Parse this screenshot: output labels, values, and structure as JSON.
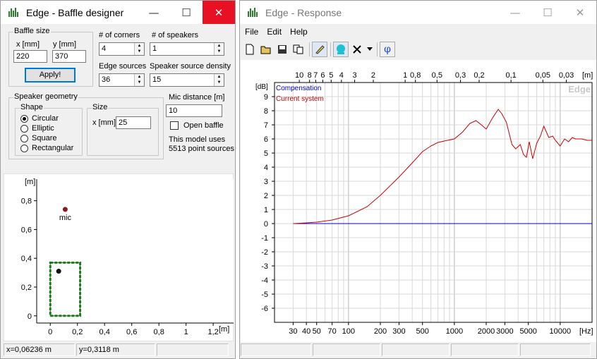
{
  "left_window": {
    "title": "Edge - Baffle designer",
    "baffle_size": {
      "group_label": "Baffle size",
      "x_label": "x [mm]",
      "y_label": "y [mm]",
      "x_value": "220",
      "y_value": "370",
      "apply_label": "Apply!"
    },
    "corners_label": "# of corners",
    "corners_value": "4",
    "speakers_label": "# of speakers",
    "speakers_value": "1",
    "edge_sources_label": "Edge sources",
    "edge_sources_value": "36",
    "density_label": "Speaker source density",
    "density_value": "15",
    "speaker_geometry": {
      "group_label": "Speaker geometry",
      "shape_label": "Shape",
      "shapes": [
        "Circular",
        "Elliptic",
        "Square",
        "Rectangular"
      ],
      "selected_shape": "Circular",
      "size_label": "Size",
      "size_x_label": "x [mm]",
      "size_x_value": "25"
    },
    "mic_distance_label": "Mic distance [m]",
    "mic_distance_value": "10",
    "open_baffle_label": "Open baffle",
    "model_info_line1": "This model uses",
    "model_info_line2": "5513 point sources",
    "plot": {
      "unit_label": "[m]",
      "y_ticks": [
        "0,8",
        "0,6",
        "0,4",
        "0,2",
        "0"
      ],
      "x_ticks": [
        "0",
        "0,2",
        "0,4",
        "0,6",
        "0,8",
        "1",
        "1,2"
      ],
      "x_unit": "[m]",
      "mic_label": "mic"
    },
    "status": {
      "x": "x=0,06236 m",
      "y": "y=0,3118 m"
    }
  },
  "right_window": {
    "title": "Edge - Response",
    "menu": [
      "File",
      "Edit",
      "Help"
    ],
    "toolbar_icons": [
      "new-file-icon",
      "open-folder-icon",
      "save-icon",
      "copy-icon",
      "pencil-icon",
      "speaker-icon",
      "delete-icon",
      "dropdown-icon",
      "phase-icon"
    ],
    "phase_glyph": "φ"
  },
  "chart_data": {
    "type": "line",
    "watermark": "Edge",
    "ylabel": "[dB]",
    "xlabel": "[Hz]",
    "x_scale": "log",
    "xlim": [
      20,
      20000
    ],
    "ylim": [
      -7,
      10
    ],
    "y_ticks": [
      9,
      8,
      7,
      6,
      5,
      4,
      3,
      2,
      1,
      0,
      -1,
      -2,
      -3,
      -4,
      -5,
      -6
    ],
    "x_tick_labels": [
      "30",
      "40",
      "50",
      "70",
      "100",
      "200",
      "300",
      "500",
      "1000",
      "2000",
      "3000",
      "5000",
      "10000"
    ],
    "top_axis_unit": "[m]",
    "top_axis_labels": [
      "10",
      "8",
      "7",
      "6",
      "5",
      "4",
      "3",
      "2",
      "1",
      "0,8",
      "0,5",
      "0,3",
      "0,2",
      "0,1",
      "0,05",
      "0,03"
    ],
    "grid": true,
    "legend_position": "top-left",
    "series": [
      {
        "name": "Compensation",
        "color": "#0000cc",
        "x": [
          30,
          20000
        ],
        "y": [
          0,
          0
        ]
      },
      {
        "name": "Current system",
        "color": "#cc0000",
        "x": [
          30,
          40,
          50,
          70,
          100,
          150,
          200,
          300,
          400,
          500,
          600,
          700,
          800,
          1000,
          1200,
          1400,
          1600,
          1800,
          2000,
          2300,
          2600,
          2800,
          3100,
          3500,
          3800,
          4200,
          4500,
          4800,
          5100,
          5500,
          6000,
          6500,
          7000,
          7300,
          7800,
          8500,
          9000,
          10000,
          11000,
          12000,
          13000,
          14000,
          16000,
          18000,
          20000
        ],
        "y": [
          0,
          0.05,
          0.1,
          0.25,
          0.55,
          1.2,
          2.0,
          3.3,
          4.3,
          5.1,
          5.5,
          5.75,
          5.85,
          6.0,
          6.5,
          7.1,
          7.3,
          7.0,
          6.7,
          7.5,
          8.1,
          7.8,
          7.2,
          5.6,
          5.3,
          5.6,
          4.9,
          4.7,
          5.8,
          4.6,
          5.7,
          6.2,
          6.9,
          6.6,
          6.1,
          6.2,
          5.9,
          5.5,
          6.0,
          5.8,
          6.1,
          6.0,
          6.0,
          5.9,
          5.9
        ]
      }
    ]
  },
  "baffle_plot_data": {
    "baffle_width_m": 0.22,
    "baffle_height_m": 0.37,
    "speaker_x_m": 0.062,
    "speaker_y_m": 0.31,
    "mic_x_m": 0.11,
    "mic_y_m": 0.74,
    "xlim": [
      -0.1,
      1.35
    ],
    "ylim": [
      -0.05,
      0.95
    ]
  }
}
